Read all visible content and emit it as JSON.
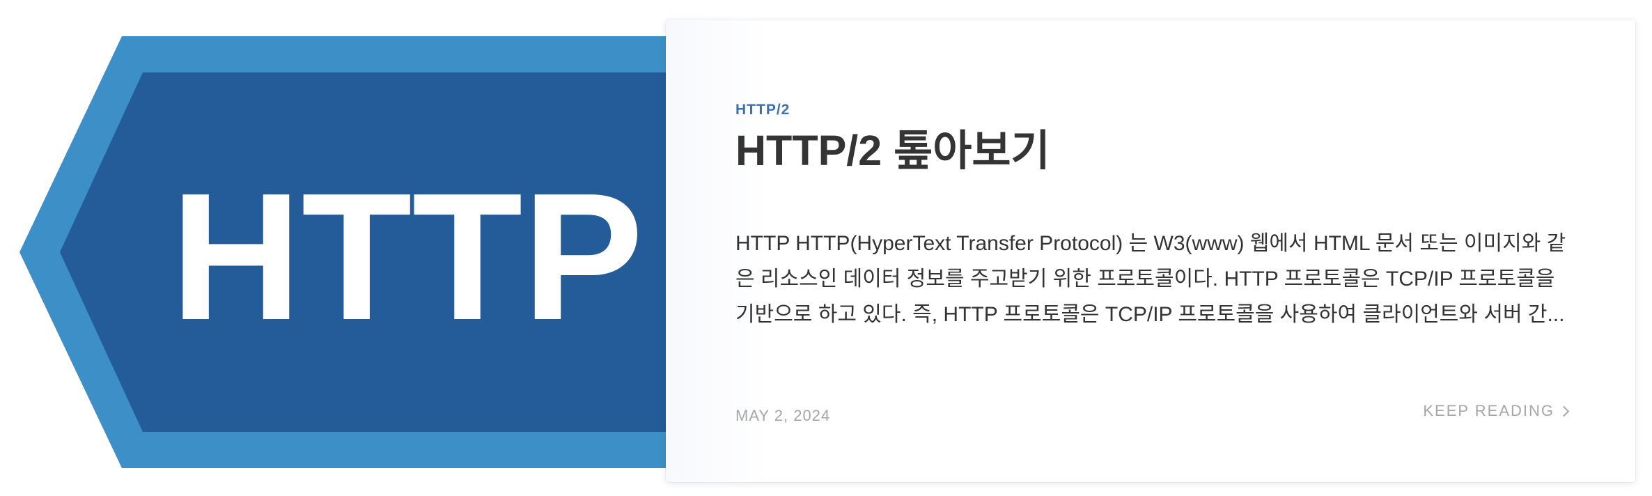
{
  "post": {
    "thumbnail": {
      "word": "HTTP",
      "colors": {
        "outer": "#3d8fc8",
        "inner": "#235c98",
        "text": "#ffffff"
      }
    },
    "category": "HTTP/2",
    "title": "HTTP/2 톺아보기",
    "excerpt": "HTTP HTTP(HyperText Transfer Protocol) 는 W3(www) 웹에서 HTML 문서 또는 이미지와 같은 리소스인 데이터 정보를 주고받기 위한 프로토콜이다. HTTP 프로토콜은 TCP/IP 프로토콜을 기반으로 하고 있다. 즉, HTTP 프로토콜은 TCP/IP 프로토콜을 사용하여 클라이언트와 서버 간...",
    "date": "MAY 2, 2024",
    "keep_reading": "KEEP READING",
    "keep_reading_icon": "chevron-right-icon",
    "accent_color": "#3a72b6"
  }
}
